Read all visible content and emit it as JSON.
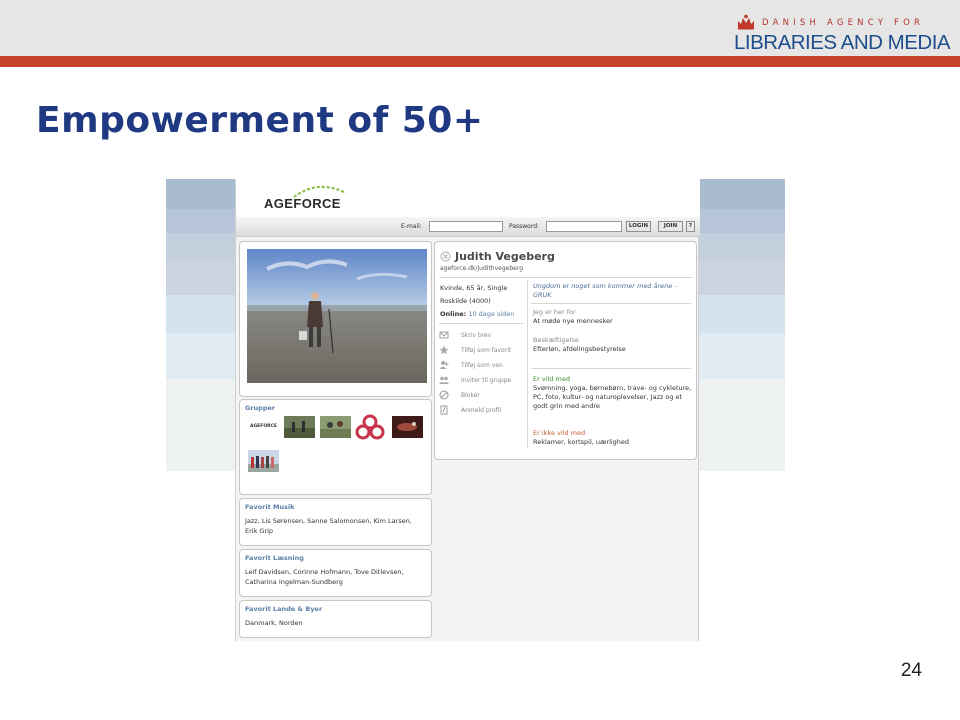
{
  "slide": {
    "title": "Empowerment of 50+",
    "page_number": "24",
    "logo": {
      "agency_line": "DANISH AGENCY FOR",
      "name_line": "LIBRARIES AND MEDIA"
    },
    "colors": {
      "title": "#1f3a82",
      "accent_bar": "#c8432a",
      "logo_blue": "#1f4e8c"
    }
  },
  "site": {
    "logo_text": "AGEFORCE",
    "login": {
      "email_label": "E-mail:",
      "password_label": "Password:",
      "login_button": "LOGIN",
      "join_button": "JOIN",
      "help_button": "?"
    },
    "profile": {
      "name": "Judith Vegeberg",
      "url": "ageforce.dk/judithvegeberg",
      "details": "Kvinde, 65 år, Single",
      "location": "Roskilde (4000)",
      "online_label": "Online:",
      "online_value": "10 dage siden",
      "quote": "Ungdom er noget som kommer med årene - GRUK",
      "here_for_label": "Jeg er her for",
      "here_for_value": "At møde nye mennesker",
      "occupation_label": "Beskæftigelse",
      "occupation_value": "Efterløn, afdelingsbestyrelse",
      "likes_label": "Er vild med",
      "likes_value": "Svømning, yoga, børnebørn, trave- og cykleture, PC, foto, kultur- og naturoplevelser, Jazz og et godt grin med andre",
      "dislikes_label": "Er ikke vild med",
      "dislikes_value": "Reklamer, kortspil, uærlighed"
    },
    "actions": [
      {
        "label": "Skriv brev",
        "icon": "letter-icon"
      },
      {
        "label": "Tilføj som favorit",
        "icon": "star-icon"
      },
      {
        "label": "Tilføj som ven",
        "icon": "friend-icon"
      },
      {
        "label": "Inviter til gruppe",
        "icon": "group-icon"
      },
      {
        "label": "Blokér",
        "icon": "block-icon"
      },
      {
        "label": "Anmeld profil",
        "icon": "report-icon"
      }
    ],
    "groups": {
      "title": "Grupper",
      "thumb_logo_text": "AGEFORCE"
    },
    "music": {
      "title": "Favorit Musik",
      "text": "Jazz, Lis Sørensen, Sanne Salomonsen, Kim Larsen, Erik Grip"
    },
    "reading": {
      "title": "Favorit Læsning",
      "text": "Leif Davidsen, Corinne Hofmann, Tove Ditlevsen, Catharina Ingelman-Sundberg"
    },
    "places": {
      "title": "Favorit Lande & Byer",
      "text": "Danmark, Norden"
    }
  }
}
